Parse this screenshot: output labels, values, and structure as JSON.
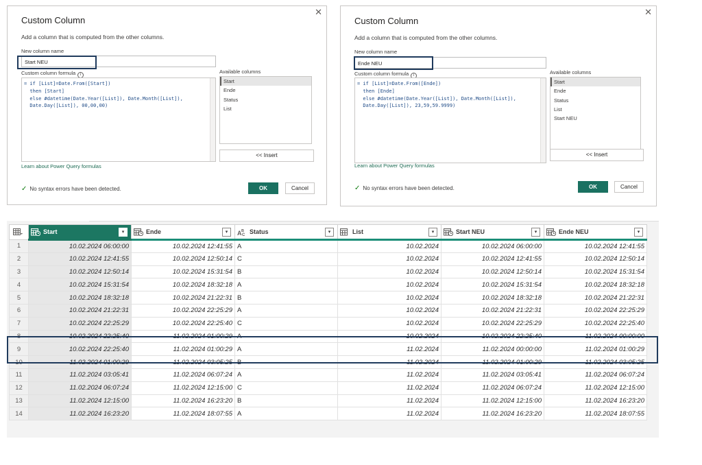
{
  "dialogs": [
    {
      "title": "Custom Column",
      "subtitle": "Add a column that is computed from the other columns.",
      "new_column_label": "New column name",
      "new_column_value": "Start NEU",
      "formula_label": "Custom column formula",
      "formula_lines": [
        "= if [List]=Date.From([Start])",
        "  then [Start]",
        "  else #datetime(Date.Year([List]), Date.Month([List]),",
        "  Date.Day([List]), 00,00,00)"
      ],
      "available_label": "Available columns",
      "available_columns": [
        "Start",
        "Ende",
        "Status",
        "List"
      ],
      "insert_label": "<< Insert",
      "learn_link": "Learn about Power Query formulas",
      "status_text": "No syntax errors have been detected.",
      "ok_label": "OK",
      "cancel_label": "Cancel"
    },
    {
      "title": "Custom Column",
      "subtitle": "Add a column that is computed from the other columns.",
      "new_column_label": "New column name",
      "new_column_value": "Ende NEU",
      "formula_label": "Custom column formula",
      "formula_lines": [
        "= if [List]=Date.From([Ende])",
        "  then [Ende]",
        "  else #datetime(Date.Year([List]), Date.Month([List]),",
        "  Date.Day([List]), 23,59,59.9999)"
      ],
      "available_label": "Available columns",
      "available_columns": [
        "Start",
        "Ende",
        "Status",
        "List",
        "Start NEU"
      ],
      "insert_label": "<< Insert",
      "learn_link": "Learn about Power Query formulas",
      "status_text": "No syntax errors have been detected.",
      "ok_label": "OK",
      "cancel_label": "Cancel"
    }
  ],
  "grid": {
    "columns": [
      {
        "name": "Start",
        "type": "datetime"
      },
      {
        "name": "Ende",
        "type": "datetime"
      },
      {
        "name": "Status",
        "type": "text"
      },
      {
        "name": "List",
        "type": "date"
      },
      {
        "name": "Start NEU",
        "type": "datetime"
      },
      {
        "name": "Ende NEU",
        "type": "datetime"
      }
    ],
    "rows": [
      [
        "1",
        "10.02.2024 06:00:00",
        "10.02.2024 12:41:55",
        "A",
        "10.02.2024",
        "10.02.2024 06:00:00",
        "10.02.2024 12:41:55"
      ],
      [
        "2",
        "10.02.2024 12:41:55",
        "10.02.2024 12:50:14",
        "C",
        "10.02.2024",
        "10.02.2024 12:41:55",
        "10.02.2024 12:50:14"
      ],
      [
        "3",
        "10.02.2024 12:50:14",
        "10.02.2024 15:31:54",
        "B",
        "10.02.2024",
        "10.02.2024 12:50:14",
        "10.02.2024 15:31:54"
      ],
      [
        "4",
        "10.02.2024 15:31:54",
        "10.02.2024 18:32:18",
        "A",
        "10.02.2024",
        "10.02.2024 15:31:54",
        "10.02.2024 18:32:18"
      ],
      [
        "5",
        "10.02.2024 18:32:18",
        "10.02.2024 21:22:31",
        "B",
        "10.02.2024",
        "10.02.2024 18:32:18",
        "10.02.2024 21:22:31"
      ],
      [
        "6",
        "10.02.2024 21:22:31",
        "10.02.2024 22:25:29",
        "A",
        "10.02.2024",
        "10.02.2024 21:22:31",
        "10.02.2024 22:25:29"
      ],
      [
        "7",
        "10.02.2024 22:25:29",
        "10.02.2024 22:25:40",
        "C",
        "10.02.2024",
        "10.02.2024 22:25:29",
        "10.02.2024 22:25:40"
      ],
      [
        "8",
        "10.02.2024 22:25:40",
        "11.02.2024 01:00:29",
        "A",
        "10.02.2024",
        "10.02.2024 22:25:40",
        "11.02.2024 00:00:00"
      ],
      [
        "9",
        "10.02.2024 22:25:40",
        "11.02.2024 01:00:29",
        "A",
        "11.02.2024",
        "11.02.2024 00:00:00",
        "11.02.2024 01:00:29"
      ],
      [
        "10",
        "11.02.2024 01:00:29",
        "11.02.2024 03:05:25",
        "B",
        "11.02.2024",
        "11.02.2024 01:00:29",
        "11.02.2024 03:05:25"
      ],
      [
        "11",
        "11.02.2024 03:05:41",
        "11.02.2024 06:07:24",
        "A",
        "11.02.2024",
        "11.02.2024 03:05:41",
        "11.02.2024 06:07:24"
      ],
      [
        "12",
        "11.02.2024 06:07:24",
        "11.02.2024 12:15:00",
        "C",
        "11.02.2024",
        "11.02.2024 06:07:24",
        "11.02.2024 12:15:00"
      ],
      [
        "13",
        "11.02.2024 12:15:00",
        "11.02.2024 16:23:20",
        "B",
        "11.02.2024",
        "11.02.2024 12:15:00",
        "11.02.2024 16:23:20"
      ],
      [
        "14",
        "11.02.2024 16:23:20",
        "11.02.2024 18:07:55",
        "A",
        "11.02.2024",
        "11.02.2024 16:23:20",
        "11.02.2024 18:07:55"
      ]
    ],
    "selected_column": "Start",
    "highlighted_rows": [
      "8",
      "9"
    ]
  },
  "colors": {
    "accent": "#1a7161",
    "header_underline": "#1c8e78",
    "highlight_border": "#1f3a5c",
    "link": "#1d6b53"
  }
}
